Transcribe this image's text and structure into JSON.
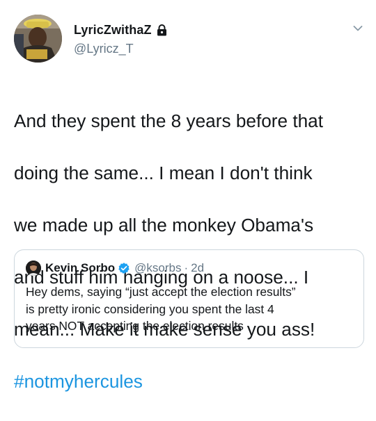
{
  "tweet": {
    "author": {
      "display_name": "LyricZwithaZ",
      "handle": "@Lyricz_T",
      "avatar_icon": "user-avatar-photo",
      "lock_icon": "lock-icon"
    },
    "menu_icon": "chevron-down-icon",
    "text_lines": [
      "And they spent the 8 years before that",
      "doing the same... I mean I don't think",
      "we made up all the monkey Obama's",
      "and stuff him hanging on a noose... I",
      "mean... Make it make sense you ass!"
    ],
    "hashtag": "#notmyhercules",
    "colors": {
      "link": "#1b95e0",
      "secondary": "#657786",
      "border": "#ccd6dd",
      "verified": "#1da1f2"
    }
  },
  "quoted_tweet": {
    "display_name": "Kevin Sorbo",
    "verified_icon": "verified-badge-icon",
    "handle": "@ksorbs",
    "separator": "·",
    "time": "2d",
    "text_lines": [
      "Hey dems, saying “just accept the election results”",
      "is pretty ironic considering you spent the last 4",
      "years NOT accepting the election results"
    ]
  }
}
